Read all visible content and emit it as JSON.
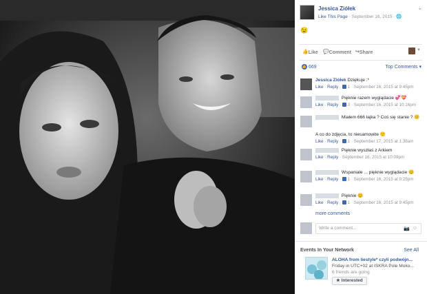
{
  "post": {
    "page_name": "Jessica Ziółek",
    "like_page": "Like This Page",
    "date": "September 16, 2015",
    "emoji": "😉",
    "chevron": "⌄"
  },
  "actions": {
    "like": "Like",
    "comment": "Comment",
    "share": "Share"
  },
  "likes_count": "669",
  "top_comments": "Top Comments ▾",
  "comments": [
    {
      "name": "Jessica Ziółek",
      "text": "Dziękuje :*",
      "meta": "1 · September 16, 2015 at 9:45pm",
      "redacted": false
    },
    {
      "name": "",
      "text": "Pięknie razem wyglądacie 💞💝",
      "meta": "3 · September 16, 2015 at 10:16pm",
      "redacted": true
    },
    {
      "name": "",
      "text": "Miałem 666 łajka ? Coś się stanie ? 😕",
      "meta": "",
      "redacted": true
    },
    {
      "name": "",
      "text": "A co do zdjęcia, to niesamowite 🙂",
      "meta": "1 · September 17, 2015 at 1:38am",
      "redacted": true
    },
    {
      "name": "",
      "text": "Pięknie wyszłaś z Arkiem",
      "meta": "September 16, 2015 at 10:09pm",
      "redacted": true
    },
    {
      "name": "",
      "text": "Wspaniale ... pięknie wyglądacie 😊",
      "meta": "1 · September 16, 2015 at 9:25pm",
      "redacted": true
    },
    {
      "name": "",
      "text": "Pięknie 😊",
      "meta": "1 · September 16, 2015 at 9:45pm",
      "redacted": true
    }
  ],
  "like_label": "Like",
  "reply_label": "Reply",
  "more_comments": "more comments",
  "write_placeholder": "Write a comment...",
  "events": {
    "title": "Events In Your Network",
    "see_all": "See All",
    "event_name": "ALOHA from liestyle* czyli podwójn...",
    "event_when": "Friday in UTC+02 at ISKRA Pole Moko...",
    "event_going": "6 friends are going",
    "button": "★ Interested"
  }
}
